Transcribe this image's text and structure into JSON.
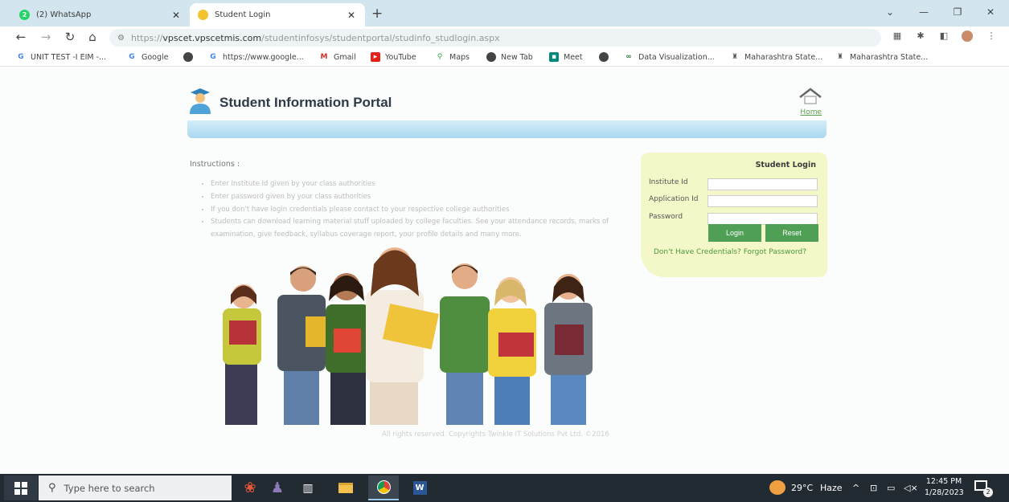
{
  "browser": {
    "tabs": [
      {
        "title": "(2) WhatsApp",
        "badge": "2",
        "active": false
      },
      {
        "title": "Student Login",
        "active": true
      }
    ],
    "new_tab_glyph": "+",
    "url_secure_part": "https://",
    "url_host": "vpscet.vpscetmis.com",
    "url_path": "/studentinfosys/studentportal/studinfo_studlogin.aspx",
    "bookmarks": [
      {
        "label": "UNIT TEST -I EIM -...",
        "icon": "google-icon"
      },
      {
        "label": "Google",
        "icon": "google-icon"
      },
      {
        "label": "",
        "icon": "globe-icon"
      },
      {
        "label": "https://www.google...",
        "icon": "google-icon"
      },
      {
        "label": "Gmail",
        "icon": "gmail-icon"
      },
      {
        "label": "YouTube",
        "icon": "youtube-icon"
      },
      {
        "label": "Maps",
        "icon": "maps-icon"
      },
      {
        "label": "New Tab",
        "icon": "globe-icon"
      },
      {
        "label": "Meet",
        "icon": "meet-icon"
      },
      {
        "label": "",
        "icon": "globe-icon"
      },
      {
        "label": "Data Visualization...",
        "icon": "link-icon"
      },
      {
        "label": "Maharashtra State...",
        "icon": "emblem-icon"
      },
      {
        "label": "Maharashtra State...",
        "icon": "emblem-icon"
      }
    ]
  },
  "portal": {
    "title": "Student Information Portal",
    "home_label": "Home",
    "instructions_title": "Instructions :",
    "instructions": [
      "Enter Institute Id given by your class authorities",
      "Enter password given by your class authorities",
      "If you don't have login credentials please contact to your respective college authorities",
      "Students can download learning material stuff uploaded by college faculties. See your attendance records, marks of examination, give feedback, syllabus coverage report, your profile details and many more."
    ],
    "copyright": "All rights reserved. Copyrights Twinkle IT Solutions Pvt Ltd. ©2016"
  },
  "login": {
    "title": "Student Login",
    "institute_label": "Institute Id",
    "institute_value": "",
    "application_label": "Application Id",
    "application_value": "",
    "password_label": "Password",
    "password_value": "",
    "login_button": "Login",
    "reset_button": "Reset",
    "no_credentials_link": "Don't Have Credentials?",
    "forgot_password_link": "Forgot Password?"
  },
  "taskbar": {
    "search_placeholder": "Type here to search",
    "weather_temp": "29°C",
    "weather_desc": "Haze",
    "time": "12:45 PM",
    "date": "1/28/2023",
    "notification_count": "2"
  },
  "colors": {
    "accent_green": "#4f9f55",
    "login_panel": "#f4f8c8",
    "header_band": "#a9d8ef",
    "taskbar": "#222a32"
  }
}
